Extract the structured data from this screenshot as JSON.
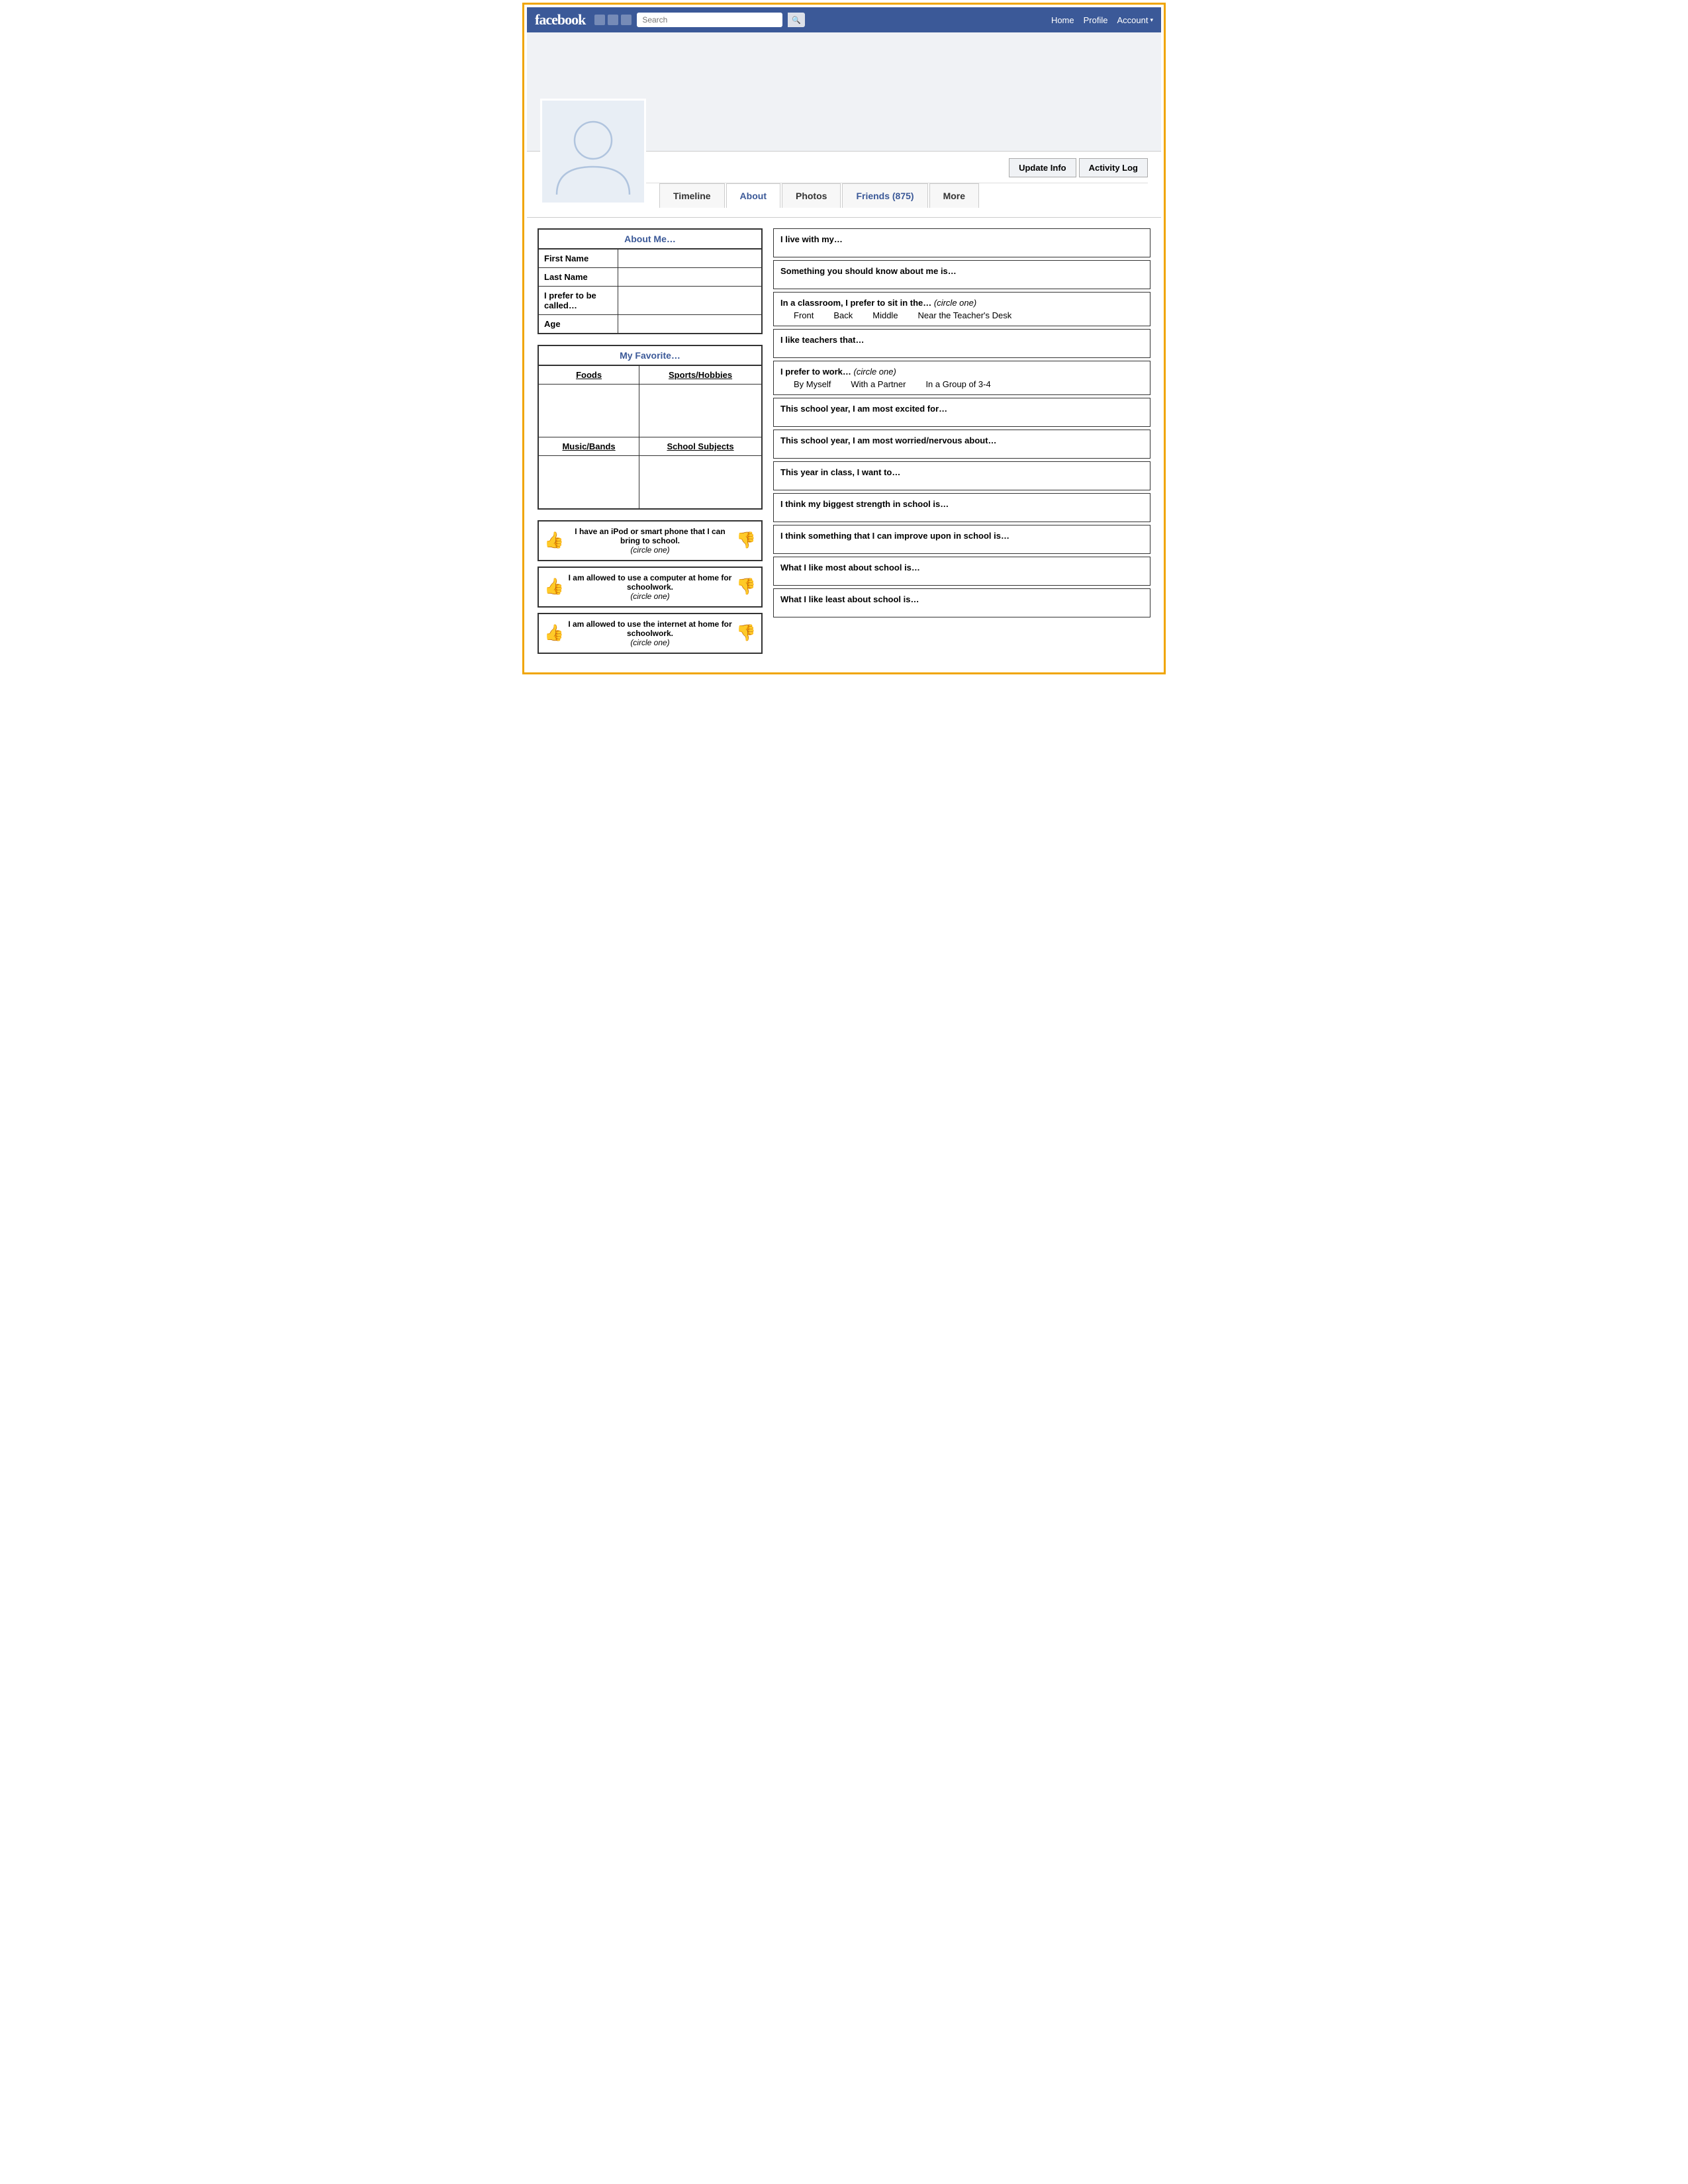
{
  "navbar": {
    "logo": "facebook",
    "search_placeholder": "Search",
    "search_btn": "🔍",
    "nav_items": [
      "Home",
      "Profile",
      "Account ▾"
    ]
  },
  "profile": {
    "update_btn": "Update Info",
    "activity_log_btn": "Activity Log",
    "tabs": [
      {
        "label": "Timeline"
      },
      {
        "label": "About"
      },
      {
        "label": "Photos"
      },
      {
        "label": "Friends (875)"
      },
      {
        "label": "More"
      }
    ]
  },
  "about_me": {
    "title": "About Me…",
    "fields": [
      {
        "label": "First Name",
        "value": ""
      },
      {
        "label": "Last Name",
        "value": ""
      },
      {
        "label": "I prefer to be called…",
        "value": ""
      },
      {
        "label": "Age",
        "value": ""
      }
    ]
  },
  "favorites": {
    "title": "My Favorite…",
    "col1_header": "Foods",
    "col2_header": "Sports/Hobbies",
    "col3_header": "Music/Bands",
    "col4_header": "School Subjects"
  },
  "circle_boxes": [
    {
      "text": "I have an iPod or smart phone that I can bring to school.",
      "circle_label": "(circle one)"
    },
    {
      "text": "I am allowed to use a computer at home for schoolwork.",
      "circle_label": "(circle one)"
    },
    {
      "text": "I am allowed to use the internet at home for schoolwork.",
      "circle_label": "(circle one)"
    }
  ],
  "questions": [
    {
      "text": "I live with my…",
      "options": [],
      "italic": ""
    },
    {
      "text": "Something you should know about me is…",
      "options": [],
      "italic": ""
    },
    {
      "text": "In a classroom, I prefer to sit in the…",
      "italic": "(circle one)",
      "options": [
        "Front",
        "Back",
        "Middle",
        "Near the Teacher's Desk"
      ]
    },
    {
      "text": "I like teachers that…",
      "options": [],
      "italic": ""
    },
    {
      "text": "I prefer to work…",
      "italic": "(circle one)",
      "options": [
        "By Myself",
        "With a Partner",
        "In a Group of 3-4"
      ]
    },
    {
      "text": "This school year, I am most excited for…",
      "options": [],
      "italic": ""
    },
    {
      "text": "This school year, I am most worried/nervous about…",
      "options": [],
      "italic": ""
    },
    {
      "text": "This year in class, I want to…",
      "options": [],
      "italic": ""
    },
    {
      "text": "I think my biggest strength in school is…",
      "options": [],
      "italic": ""
    },
    {
      "text": "I think something that I can improve upon in school is…",
      "options": [],
      "italic": ""
    },
    {
      "text": "What I like most about school is…",
      "options": [],
      "italic": ""
    },
    {
      "text": "What I like least about school is…",
      "options": [],
      "italic": ""
    }
  ]
}
